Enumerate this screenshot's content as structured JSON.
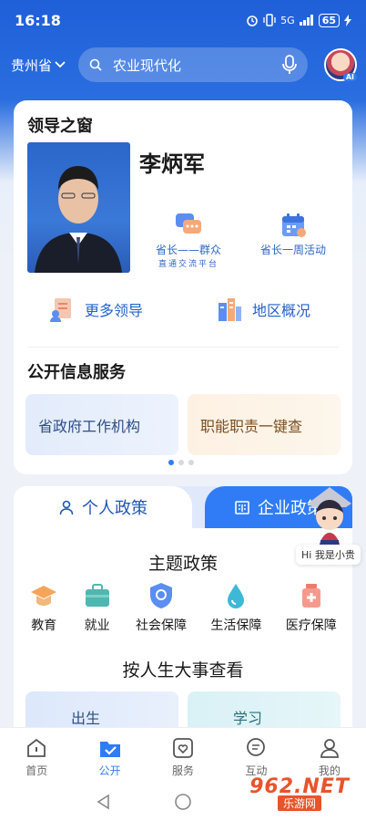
{
  "status_bar": {
    "time": "16:18",
    "network": "5G",
    "battery": "65"
  },
  "header": {
    "region": "贵州省",
    "search_text": "农业现代化",
    "avatar_badge": "AI"
  },
  "leaders": {
    "title": "领导之窗",
    "name": "李炳军",
    "actions": [
      {
        "label": "省长——群众",
        "sub": "直通交流平台"
      },
      {
        "label": "省长一周活动"
      }
    ],
    "links": [
      "更多领导",
      "地区概况"
    ]
  },
  "public_services": {
    "title": "公开信息服务",
    "tiles": [
      "省政府工作机构",
      "职能职责一键查"
    ]
  },
  "policy": {
    "tabs": [
      "个人政策",
      "企业政策"
    ],
    "topic_title": "主题政策",
    "categories": [
      "教育",
      "就业",
      "社会保障",
      "生活保障",
      "医疗保障"
    ],
    "life_title": "按人生大事查看",
    "life_items": [
      "出生",
      "学习"
    ]
  },
  "mascot_bubble": "Hi 我是小贵",
  "bottom_nav": [
    "首页",
    "公开",
    "服务",
    "互动",
    "我的"
  ],
  "watermark": {
    "main": "962.NET",
    "sub": "乐游网"
  },
  "colors": {
    "primary": "#2f7cf6",
    "header_blue": "#1f5fd8",
    "link_blue": "#2563c9"
  }
}
